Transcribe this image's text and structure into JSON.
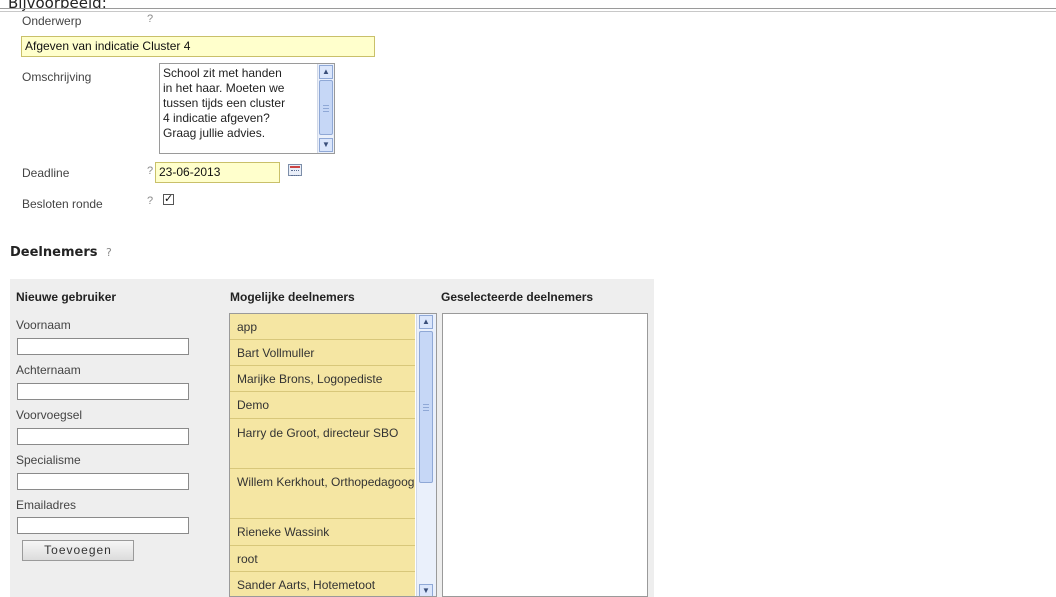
{
  "page": {
    "top_title": "Bijvoorbeeld:"
  },
  "form": {
    "subject": {
      "label": "Onderwerp",
      "help": "?",
      "value": "Afgeven van indicatie Cluster 4"
    },
    "description": {
      "label": "Omschrijving",
      "value": "School zit met handen\nin het haar. Moeten we\ntussen tijds een cluster\n4 indicatie afgeven?\nGraag jullie advies."
    },
    "deadline": {
      "label": "Deadline",
      "help": "?",
      "value": "23-06-2013",
      "icon": "calendar-icon"
    },
    "closed_round": {
      "label": "Besloten ronde",
      "help": "?",
      "checked": true,
      "check_glyph": "✓"
    }
  },
  "participants": {
    "title": "Deelnemers",
    "help": "?",
    "new_user": {
      "header": "Nieuwe gebruiker",
      "first_name_label": "Voornaam",
      "last_name_label": "Achternaam",
      "prefix_label": "Voorvoegsel",
      "specialism_label": "Specialisme",
      "email_label": "Emailadres",
      "add_button": "Toevoegen"
    },
    "possible": {
      "header": "Mogelijke deelnemers",
      "items": [
        "app",
        "Bart Vollmuller",
        "Marijke Brons, Logopediste",
        "Demo",
        "Harry de Groot, directeur SBO",
        "Willem Kerkhout, Orthopedagoog",
        "Rieneke Wassink",
        "root",
        "Sander Aarts, Hotemetoot"
      ]
    },
    "selected": {
      "header": "Geselecteerde deelnemers",
      "items": []
    }
  },
  "scrollbar": {
    "up_glyph": "▲",
    "down_glyph": "▼"
  },
  "colors": {
    "input_yellow": "#ffffcc",
    "list_yellow": "#f5e6a3",
    "panel_gray": "#eeeeee",
    "scrollbar_blue": "#c6d7f6"
  }
}
